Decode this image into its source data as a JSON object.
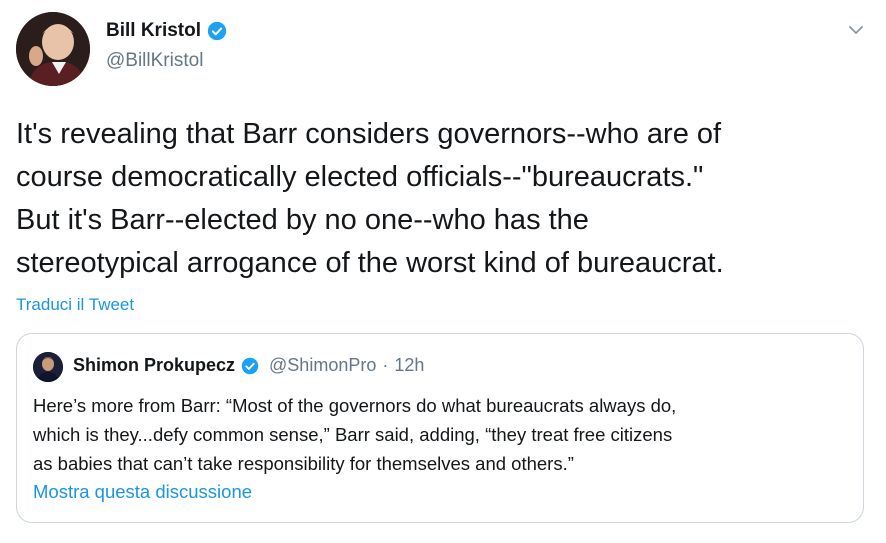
{
  "author": {
    "name": "Bill Kristol",
    "handle": "@BillKristol",
    "verified": true
  },
  "tweet": {
    "lines": [
      "It's revealing that Barr considers governors--who are of",
      "course democratically elected officials--\"bureaucrats.\"",
      "But it's Barr--elected by no one--who has the",
      "stereotypical arrogance of the worst kind of bureaucrat."
    ],
    "translate_label": "Traduci il Tweet"
  },
  "quoted": {
    "name": "Shimon Prokupecz",
    "handle": "@ShimonPro",
    "separator": "·",
    "time": "12h",
    "verified": true,
    "lines": [
      "Here’s more from Barr: “Most of the governors do what bureaucrats always do,",
      "which is they...defy common sense,” Barr said, adding, “they treat free citizens",
      "as babies that can’t take responsibility for themselves and others.”"
    ],
    "show_thread_label": "Mostra questa discussione"
  },
  "icons": {
    "verified": "verified-badge-icon",
    "menu": "chevron-down-icon"
  },
  "colors": {
    "link": "#1b95e0",
    "verified": "#1da1f2",
    "secondary_text": "#657786",
    "border": "#ccd6dd"
  }
}
